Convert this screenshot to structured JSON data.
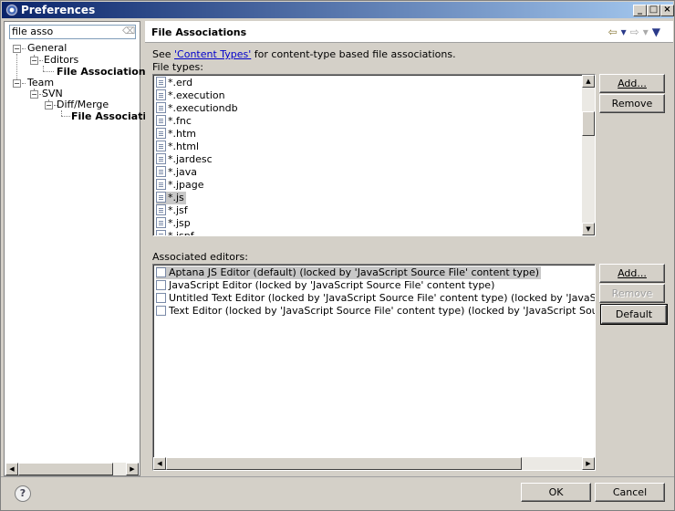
{
  "window": {
    "title": "Preferences",
    "min": "_",
    "max": "□",
    "close": "×"
  },
  "filter": {
    "value": "file asso"
  },
  "tree": {
    "general": "General",
    "editors": "Editors",
    "file_assoc_1": "File Associations",
    "team": "Team",
    "svn": "SVN",
    "diff_merge": "Diff/Merge",
    "file_assoc_2": "File Associations",
    "minus": "−"
  },
  "page": {
    "title": "File Associations",
    "desc_prefix": "See ",
    "desc_link": "'Content Types'",
    "desc_suffix": " for content-type based file associations.",
    "file_types_label": "File types:",
    "file_types": [
      "*.erd",
      "*.execution",
      "*.executiondb",
      "*.fnc",
      "*.htm",
      "*.html",
      "*.jardesc",
      "*.java",
      "*.jpage",
      "*.js",
      "*.jsf",
      "*.jsp",
      "*.jspf"
    ],
    "selected_type": "*.js",
    "assoc_label": "Associated editors:",
    "editors": [
      "Aptana JS Editor (default) (locked by 'JavaScript Source File' content type)",
      "JavaScript Editor (locked by 'JavaScript Source File' content type)",
      "Untitled Text Editor (locked by 'JavaScript Source File' content type) (locked by 'JavaScript Source",
      "Text Editor (locked by 'JavaScript Source File' content type) (locked by 'JavaScript Source File' cor"
    ],
    "buttons": {
      "add_type": "Add...",
      "remove_type": "Remove",
      "add_editor": "Add...",
      "remove_editor": "Remove",
      "default": "Default"
    }
  },
  "nav": {
    "back": "⇦",
    "dropdown": "▾",
    "forward": "⇨",
    "menu": "▼"
  },
  "scroll": {
    "up": "▲",
    "down": "▼",
    "left": "◀",
    "right": "▶"
  },
  "footer": {
    "help": "?",
    "ok": "OK",
    "cancel": "Cancel"
  }
}
